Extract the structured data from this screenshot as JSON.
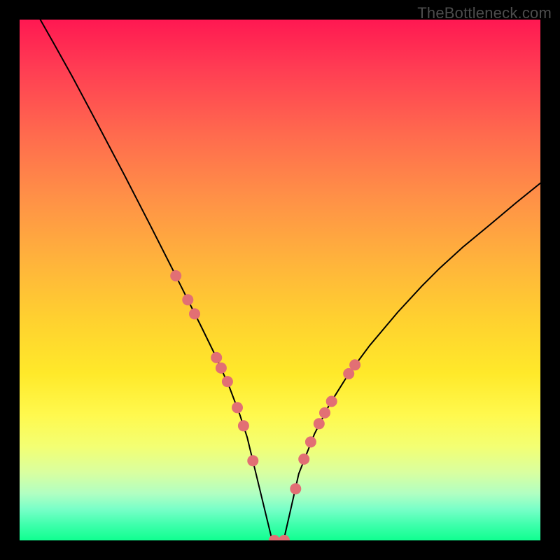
{
  "attribution": "TheBottleneck.com",
  "colors": {
    "background": "#000000",
    "dot": "#e26f74",
    "curve": "#000000",
    "gradient_top": "#ff1852",
    "gradient_bottom": "#10ff90"
  },
  "chart_data": {
    "type": "line",
    "title": "",
    "xlabel": "",
    "ylabel": "",
    "xlim": [
      0,
      100
    ],
    "ylim": [
      0,
      100
    ],
    "grid": false,
    "legend": false,
    "note": "Bottleneck-style V curve; y≈0 at the balanced point around x≈47; background gradient maps red→green to high→low bottleneck.",
    "series": [
      {
        "name": "curve",
        "x": [
          0,
          6.7,
          10.1,
          15.1,
          20.2,
          25.1,
          29.2,
          32.3,
          34.9,
          37.6,
          40.3,
          42.3,
          43.7,
          45.3,
          48.5,
          50.7,
          52.2,
          53.6,
          56.6,
          59.5,
          63.2,
          67.2,
          72.6,
          77.2,
          80.6,
          85.1,
          90.3,
          95.3,
          100
        ],
        "y": [
          107,
          95.2,
          89.1,
          79.7,
          70.0,
          60.5,
          52.4,
          46.2,
          41.0,
          35.5,
          29.4,
          24.1,
          19.8,
          13.2,
          0.0,
          0.0,
          6.6,
          12.8,
          20.4,
          26.1,
          32.0,
          37.4,
          43.8,
          48.8,
          52.2,
          56.3,
          60.6,
          64.8,
          68.6
        ]
      }
    ],
    "markers": {
      "name": "dots",
      "x": [
        30.0,
        32.3,
        33.6,
        37.8,
        38.7,
        39.9,
        41.8,
        43.0,
        44.8,
        48.9,
        50.8,
        53.0,
        54.6,
        55.9,
        57.5,
        58.6,
        59.9,
        63.2,
        64.4
      ],
      "y": [
        50.8,
        46.2,
        43.5,
        35.1,
        33.1,
        30.5,
        25.5,
        22.0,
        15.3,
        0.0,
        0.0,
        9.9,
        15.6,
        18.9,
        22.4,
        24.5,
        26.7,
        32.0,
        33.7
      ]
    }
  }
}
